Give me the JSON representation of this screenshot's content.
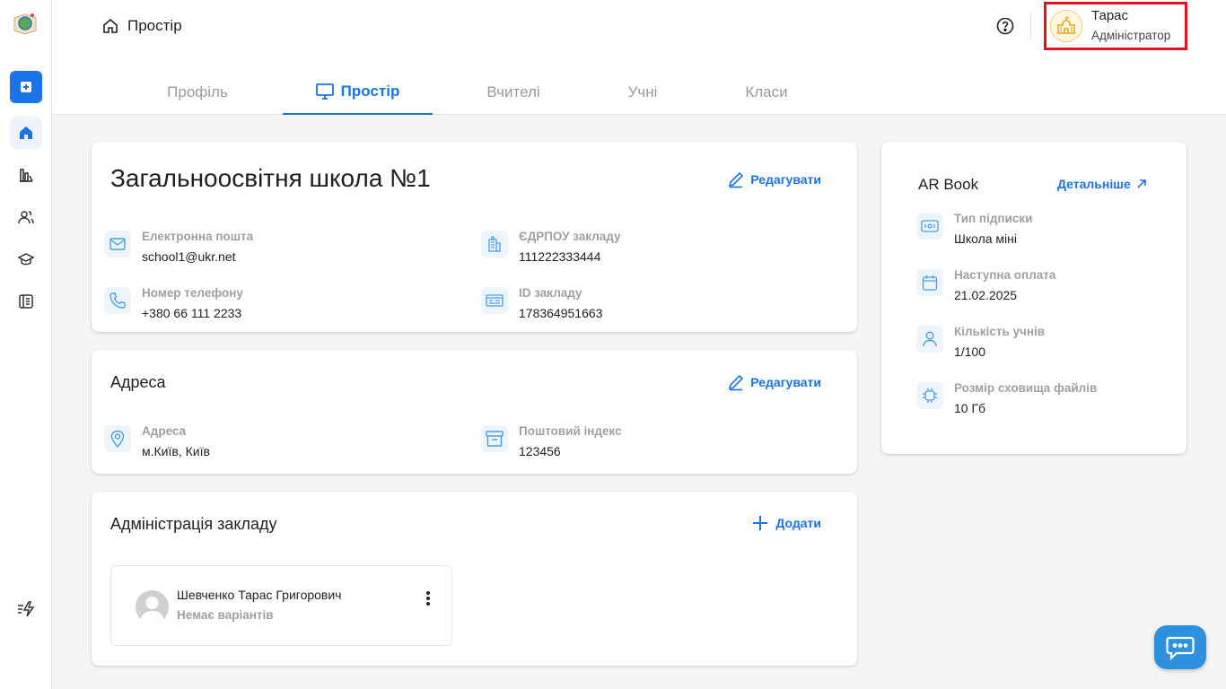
{
  "header": {
    "breadcrumb": "Простір",
    "user": {
      "name": "Тарас",
      "role": "Адміністратор"
    }
  },
  "tabs": [
    {
      "label": "Профіль",
      "active": false
    },
    {
      "label": "Простір",
      "active": true
    },
    {
      "label": "Вчителі",
      "active": false
    },
    {
      "label": "Учні",
      "active": false
    },
    {
      "label": "Класи",
      "active": false
    }
  ],
  "school": {
    "title": "Загальноосвітня школа №1",
    "edit_label": "Редагувати",
    "fields": {
      "email": {
        "label": "Електронна пошта",
        "value": "school1@ukr.net",
        "icon": "mail-icon"
      },
      "edrpou": {
        "label": "ЄДРПОУ закладу",
        "value": "111222333444",
        "icon": "building-icon"
      },
      "phone": {
        "label": "Номер телефону",
        "value": "+380 66 111 2233",
        "icon": "phone-icon"
      },
      "id": {
        "label": "ID закладу",
        "value": "178364951663",
        "icon": "id-card-icon"
      }
    }
  },
  "address": {
    "title": "Адреса",
    "edit_label": "Редагувати",
    "fields": {
      "address": {
        "label": "Адреса",
        "value": "м.Київ, Київ",
        "icon": "map-pin-icon"
      },
      "postal": {
        "label": "Поштовий індекс",
        "value": "123456",
        "icon": "archive-box-icon"
      }
    }
  },
  "administration": {
    "title": "Адміністрація закладу",
    "add_label": "Додати",
    "members": [
      {
        "name": "Шевченко Тарас Григорович",
        "subtitle": "Немає варіантів"
      }
    ]
  },
  "ar_book": {
    "title": "AR Book",
    "more_label": "Детальніше",
    "fields": {
      "subscription": {
        "label": "Тип підписки",
        "value": "Школа міні"
      },
      "next_payment": {
        "label": "Наступна оплата",
        "value": "21.02.2025"
      },
      "students": {
        "label": "Кількість учнів",
        "value": "1/100"
      },
      "storage": {
        "label": "Розмір сховища файлів",
        "value": "10 Гб"
      }
    }
  },
  "colors": {
    "accent": "#1a73e8",
    "highlight_border": "#e0141e",
    "chat_button": "#2d91df"
  }
}
